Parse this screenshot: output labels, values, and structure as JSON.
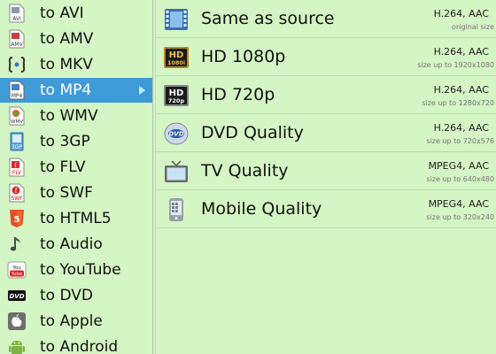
{
  "formats": [
    {
      "label": "to AVI",
      "icon": "avi-file-icon"
    },
    {
      "label": "to AMV",
      "icon": "amv-file-icon"
    },
    {
      "label": "to MKV",
      "icon": "mkv-icon"
    },
    {
      "label": "to MP4",
      "icon": "mp4-file-icon",
      "selected": true
    },
    {
      "label": "to WMV",
      "icon": "wmv-file-icon"
    },
    {
      "label": "to 3GP",
      "icon": "3gp-file-icon"
    },
    {
      "label": "to FLV",
      "icon": "flv-file-icon"
    },
    {
      "label": "to SWF",
      "icon": "swf-file-icon"
    },
    {
      "label": "to HTML5",
      "icon": "html5-icon"
    },
    {
      "label": "to Audio",
      "icon": "music-note-icon"
    },
    {
      "label": "to YouTube",
      "icon": "youtube-icon"
    },
    {
      "label": "to DVD",
      "icon": "dvd-icon"
    },
    {
      "label": "to Apple",
      "icon": "apple-icon"
    },
    {
      "label": "to Android",
      "icon": "android-icon"
    }
  ],
  "qualities": [
    {
      "name": "Same as source",
      "codec": "H.264, AAC",
      "size": "original size",
      "icon": "film-strip-icon"
    },
    {
      "name": "HD 1080p",
      "codec": "H.264, AAC",
      "size": "size up to 1920x1080",
      "icon": "hd-1080-icon"
    },
    {
      "name": "HD 720p",
      "codec": "H.264, AAC",
      "size": "size up to 1280x720",
      "icon": "hd-720-icon"
    },
    {
      "name": "DVD Quality",
      "codec": "H.264, AAC",
      "size": "size up to 720x576",
      "icon": "dvd-disc-icon"
    },
    {
      "name": "TV Quality",
      "codec": "MPEG4, AAC",
      "size": "size up to 640x480",
      "icon": "tv-icon"
    },
    {
      "name": "Mobile Quality",
      "codec": "MPEG4, AAC",
      "size": "size up to 320x240",
      "icon": "mobile-phone-icon"
    }
  ],
  "icon_text": {
    "avi": "AVI",
    "amv": "AMV",
    "mp4": "MP4",
    "wmv": "WMV",
    "gp3": "3GP",
    "flv": "FLV",
    "swf": "SWF",
    "html5": "5",
    "youtube": "You Tube",
    "dvd": "DVD",
    "hd": "HD",
    "p1080": "1080i",
    "p720": "720p",
    "dvd_disc": "DVD"
  },
  "colors": {
    "background": "#d4f5c4",
    "selection": "#3f9ad8"
  }
}
